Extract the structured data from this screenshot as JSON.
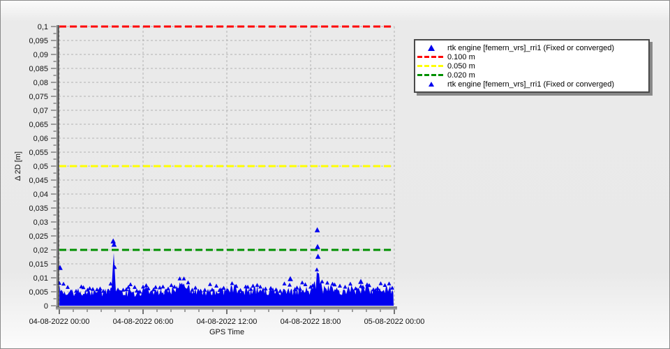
{
  "window": {
    "background": "#e9e9e9"
  },
  "chart_data": {
    "type": "scatter",
    "title": "",
    "xlabel": "GPS Time",
    "ylabel": "Δ 2D [m]",
    "xlim_hours": [
      0,
      24
    ],
    "ylim": [
      0,
      0.1
    ],
    "y_tick_step": 0.005,
    "y_tick_labels": [
      "0,1",
      "0,095",
      "0,09",
      "0,085",
      "0,08",
      "0,075",
      "0,07",
      "0,065",
      "0,06",
      "0,055",
      "0,05",
      "0,045",
      "0,04",
      "0,035",
      "0,03",
      "0,025",
      "0,02",
      "0,015",
      "0,01",
      "0,005",
      "0"
    ],
    "x_tick_hours": [
      0,
      6,
      12,
      18,
      24
    ],
    "x_tick_labels": [
      "04-08-2022 00:00",
      "04-08-2022 06:00",
      "04-08-2022 12:00",
      "04-08-2022 18:00",
      "05-08-2022 00:00"
    ],
    "grid": {
      "shown": true,
      "style": "dashed",
      "color": "#b3b3b3"
    },
    "thresholds": [
      {
        "label": "0.100 m",
        "value": 0.1,
        "color": "#ff0000"
      },
      {
        "label": "0.050 m",
        "value": 0.05,
        "color": "#ffff00"
      },
      {
        "label": "0.020 m",
        "value": 0.02,
        "color": "#009000"
      }
    ],
    "series": [
      {
        "name": "rtk engine [femern_vrs]_rri1 (Fixed or converged)",
        "marker": "triangle",
        "color": "#0000ee",
        "data_start_hour": 0,
        "data_end_hour": 23.95,
        "noise_envelope_h_v": [
          [
            0,
            0.0095
          ],
          [
            0.1,
            0.008
          ],
          [
            0.5,
            0.0065
          ],
          [
            1,
            0.006
          ],
          [
            1.5,
            0.0068
          ],
          [
            2,
            0.006
          ],
          [
            2.5,
            0.0062
          ],
          [
            2.8,
            0.0075
          ],
          [
            3.1,
            0.006
          ],
          [
            3.5,
            0.0065
          ],
          [
            3.75,
            0.008
          ],
          [
            3.82,
            0.014
          ],
          [
            3.88,
            0.021
          ],
          [
            3.95,
            0.0165
          ],
          [
            4.02,
            0.009
          ],
          [
            4.1,
            0.0065
          ],
          [
            4.5,
            0.006
          ],
          [
            5.0,
            0.0062
          ],
          [
            5.15,
            0.0085
          ],
          [
            5.3,
            0.0062
          ],
          [
            5.8,
            0.006
          ],
          [
            6.3,
            0.0078
          ],
          [
            6.6,
            0.006
          ],
          [
            7,
            0.0065
          ],
          [
            7.5,
            0.0062
          ],
          [
            8,
            0.0068
          ],
          [
            8.4,
            0.008
          ],
          [
            8.7,
            0.0095
          ],
          [
            9,
            0.0092
          ],
          [
            9.3,
            0.0078
          ],
          [
            9.6,
            0.0065
          ],
          [
            10,
            0.0068
          ],
          [
            10.5,
            0.0062
          ],
          [
            10.8,
            0.0075
          ],
          [
            11.2,
            0.0065
          ],
          [
            11.6,
            0.0072
          ],
          [
            12,
            0.0065
          ],
          [
            12.5,
            0.0085
          ],
          [
            12.8,
            0.0068
          ],
          [
            13.3,
            0.0072
          ],
          [
            13.8,
            0.0065
          ],
          [
            14.3,
            0.0075
          ],
          [
            14.8,
            0.0068
          ],
          [
            15.3,
            0.0072
          ],
          [
            15.8,
            0.0065
          ],
          [
            16.3,
            0.0078
          ],
          [
            16.7,
            0.0068
          ],
          [
            17.2,
            0.0075
          ],
          [
            17.6,
            0.008
          ],
          [
            18,
            0.0072
          ],
          [
            18.3,
            0.009
          ],
          [
            18.45,
            0.0125
          ],
          [
            18.55,
            0.013
          ],
          [
            18.7,
            0.0095
          ],
          [
            18.9,
            0.0072
          ],
          [
            19.3,
            0.0078
          ],
          [
            19.8,
            0.008
          ],
          [
            20.2,
            0.007
          ],
          [
            20.7,
            0.0078
          ],
          [
            21.2,
            0.0072
          ],
          [
            21.6,
            0.008
          ],
          [
            22,
            0.0075
          ],
          [
            22.4,
            0.007
          ],
          [
            22.8,
            0.0078
          ],
          [
            23.2,
            0.0072
          ],
          [
            23.6,
            0.0075
          ],
          [
            23.95,
            0.007
          ]
        ],
        "outliers_h_v": [
          [
            0.05,
            0.0135
          ],
          [
            3.86,
            0.023
          ],
          [
            3.92,
            0.0218
          ],
          [
            16.55,
            0.0095
          ],
          [
            18.48,
            0.027
          ],
          [
            18.5,
            0.021
          ],
          [
            18.53,
            0.0175
          ],
          [
            21.6,
            0.0085
          ]
        ]
      }
    ],
    "legend": {
      "position": "top-right",
      "entries": [
        {
          "type": "marker",
          "size": "large",
          "color": "#0000ee",
          "label": "rtk engine [femern_vrs]_rri1 (Fixed or converged)"
        },
        {
          "type": "line",
          "size": "",
          "color": "#ff0000",
          "label": "0.100 m"
        },
        {
          "type": "line",
          "size": "",
          "color": "#ffff00",
          "label": "0.050 m"
        },
        {
          "type": "line",
          "size": "",
          "color": "#009000",
          "label": "0.020 m"
        },
        {
          "type": "marker",
          "size": "small",
          "color": "#0000ee",
          "label": "rtk engine [femern_vrs]_rri1 (Fixed or converged)"
        }
      ]
    }
  }
}
